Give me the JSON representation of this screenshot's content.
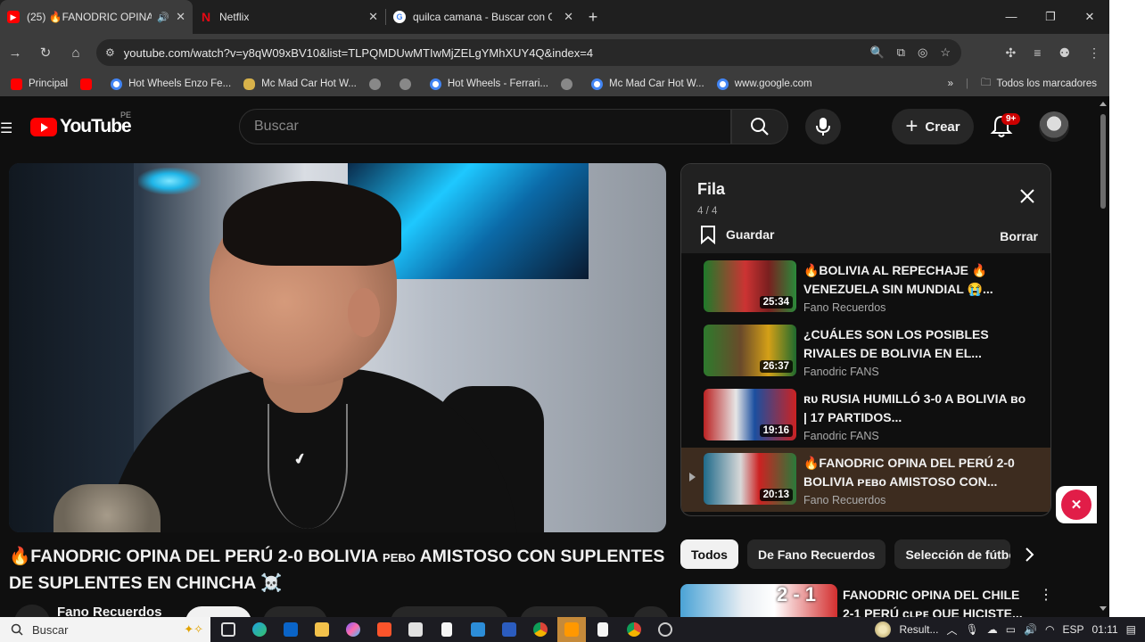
{
  "browser": {
    "tabs": [
      {
        "title": "(25) 🔥FANODRIC OPINA DEL",
        "favicon": "youtube-icon",
        "audio": true,
        "active": true
      },
      {
        "title": "Netflix",
        "favicon": "netflix-icon",
        "active": false
      },
      {
        "title": "quilca camana - Buscar con Goo",
        "favicon": "google-icon",
        "active": false
      }
    ],
    "url": "youtube.com/watch?v=y8qW09xBV10&list=TLPQMDUwMTIwMjZELgYMhXUY4Q&index=4",
    "bookmarks": [
      {
        "label": "Principal",
        "icon": "youtube-icon"
      },
      {
        "label": "",
        "icon": "youtube-icon"
      },
      {
        "label": "Hot Wheels Enzo Fe...",
        "icon": "google-icon"
      },
      {
        "label": "Mc Mad Car Hot W...",
        "icon": "car-icon"
      },
      {
        "label": "",
        "icon": "globe-icon"
      },
      {
        "label": "",
        "icon": "globe-icon"
      },
      {
        "label": "Hot Wheels - Ferrari...",
        "icon": "google-icon"
      },
      {
        "label": "",
        "icon": "globe-icon"
      },
      {
        "label": "Mc Mad Car Hot W...",
        "icon": "google-icon"
      },
      {
        "label": "www.google.com",
        "icon": "google-icon"
      }
    ],
    "all_bookmarks": "Todos los marcadores",
    "more_glyph": "»"
  },
  "youtube": {
    "logo": "YouTube",
    "country": "PE",
    "search_placeholder": "Buscar",
    "create_label": "Crear",
    "notif_badge": "9+"
  },
  "video": {
    "title_main": "🔥FANODRIC OPINA DEL PERÚ 2-0 BOLIVIA ",
    "title_small": "PEBO",
    "title_rest": " AMISTOSO CON SUPLENTES DE SUPLENTES EN CHINCHA ☠️",
    "channel": "Fano Recuerdos",
    "nike_swoosh": "✔"
  },
  "queue": {
    "title": "Fila",
    "count": "4 / 4",
    "save_label": "Guardar",
    "clear_label": "Borrar",
    "items": [
      {
        "title": "🔥BOLIVIA AL REPECHAJE 🔥 VENEZUELA SIN MUNDIAL 😭...",
        "channel": "Fano Recuerdos",
        "duration": "25:34",
        "current": false
      },
      {
        "title": "¿CUÁLES SON LOS POSIBLES RIVALES DE BOLIVIA EN EL...",
        "channel": "Fanodric FANS",
        "duration": "26:37",
        "current": false
      },
      {
        "title": "ʀᴜ RUSIA HUMILLÓ 3-0 A BOLIVIA ʙᴏ | 17 PARTIDOS...",
        "channel": "Fanodric FANS",
        "duration": "19:16",
        "current": false
      },
      {
        "title": "🔥FANODRIC OPINA DEL PERÚ 2-0 BOLIVIA ᴘᴇʙᴏ AMISTOSO CON...",
        "channel": "Fano Recuerdos",
        "duration": "20:13",
        "current": true
      }
    ]
  },
  "chips": [
    "Todos",
    "De Fano Recuerdos",
    "Selección de fútbol"
  ],
  "recommendation": {
    "title": "FANODRIC OPINA DEL CHILE 2-1 PERÚ ᴄʟᴘᴇ QUE HICISTE...",
    "score": "2 - 1"
  },
  "taskbar": {
    "search_label": "Buscar",
    "weather_label": "Result...",
    "language": "ESP",
    "time": "01:11"
  }
}
